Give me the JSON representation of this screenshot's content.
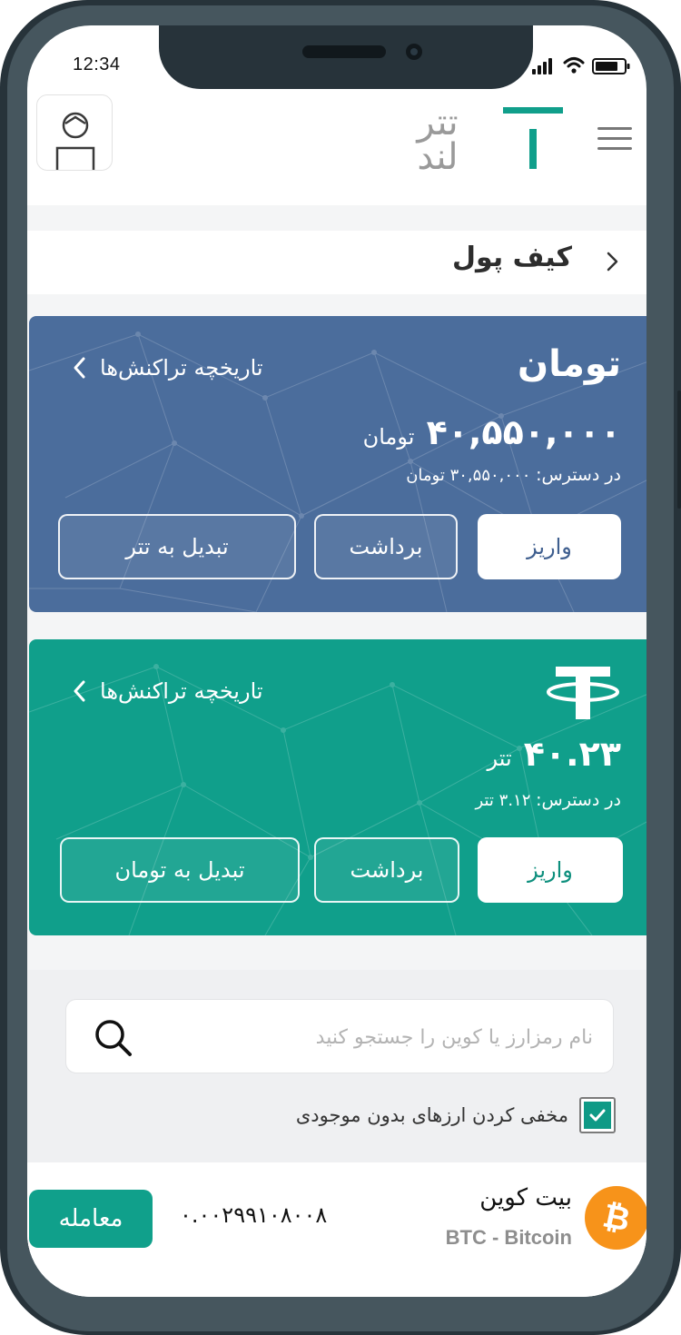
{
  "status": {
    "time": "12:34"
  },
  "header": {
    "logo_top": "تتر",
    "logo_bottom": "لند",
    "logo_mark": "T"
  },
  "page": {
    "title": "کیف پول"
  },
  "toman_card": {
    "title": "تومان",
    "history_link": "تاریخچه تراکنش‌ها",
    "balance_amount": "۴۰,۵۵۰,۰۰۰",
    "balance_unit": "تومان",
    "available_label": "در دسترس:",
    "available_value": "۳۰,۵۵۰,۰۰۰",
    "available_unit": "تومان",
    "deposit_label": "واریز",
    "withdraw_label": "برداشت",
    "convert_label": "تبدیل به تتر"
  },
  "tether_card": {
    "history_link": "تاریخچه تراکنش‌ها",
    "balance_amount": "۴۰.۲۳",
    "balance_unit": "تتر",
    "available_label": "در دسترس:",
    "available_value": "۳.۱۲",
    "available_unit": "تتر",
    "deposit_label": "واریز",
    "withdraw_label": "برداشت",
    "convert_label": "تبدیل به تومان"
  },
  "search": {
    "placeholder": "نام رمزارز یا کوین را جستجو کنید",
    "hide_zero_label": "مخفی کردن ارزهای بدون موجودی",
    "hide_zero_checked": true
  },
  "coins": [
    {
      "name": "بیت کوین",
      "symbol_line": "BTC - Bitcoin",
      "amount": "۰.۰۰۲۹۹۱۰۸۰۰۸",
      "trade_label": "معامله",
      "icon": "bitcoin-icon"
    }
  ],
  "colors": {
    "toman_card": "#4b6d9c",
    "tether_card": "#109f8b",
    "brand": "#0f9a86",
    "bitcoin": "#f7931a"
  }
}
